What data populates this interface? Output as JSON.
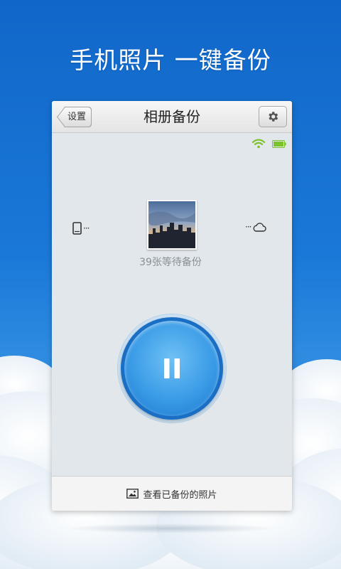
{
  "headline": "手机照片 一键备份",
  "app": {
    "back_label": "设置",
    "title": "相册备份",
    "settings_icon": "gear-icon"
  },
  "status": {
    "wifi_icon": "wifi-icon",
    "battery_icon": "battery-icon",
    "accent_color": "#7cc22a"
  },
  "transfer": {
    "source_icon": "phone-icon",
    "target_icon": "cloud-icon",
    "dots": "···",
    "waiting_text": "39张等待备份"
  },
  "control": {
    "pause_icon": "pause-icon",
    "accent_color": "#1a6fc4"
  },
  "footer": {
    "view_label": "查看已备份的照片",
    "view_icon": "image-icon"
  }
}
